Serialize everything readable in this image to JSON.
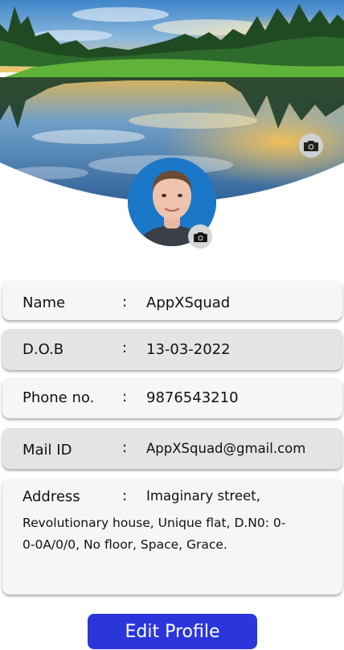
{
  "profile": {
    "fields": [
      {
        "label": "Name",
        "separator": ":",
        "value": "AppXSquad"
      },
      {
        "label": "D.O.B",
        "separator": ":",
        "value": "13-03-2022"
      },
      {
        "label": "Phone no.",
        "separator": ":",
        "value": "9876543210"
      },
      {
        "label": "Mail ID",
        "separator": ":",
        "value": "AppXSquad@gmail.com"
      }
    ],
    "address": {
      "label": "Address",
      "separator": ":",
      "line1": "Imaginary street,",
      "rest": "Revolutionary house, Unique flat, D.N0: 0-0-0A/0/0, No floor, Space, Grace."
    }
  },
  "actions": {
    "edit_profile_label": "Edit Profile"
  },
  "icons": {
    "cover_change": "camera-icon",
    "avatar_change": "camera-icon"
  },
  "colors": {
    "primary_button": "#2a36da",
    "card_light": "#f6f6f6",
    "card_dark": "#e4e4e4"
  }
}
